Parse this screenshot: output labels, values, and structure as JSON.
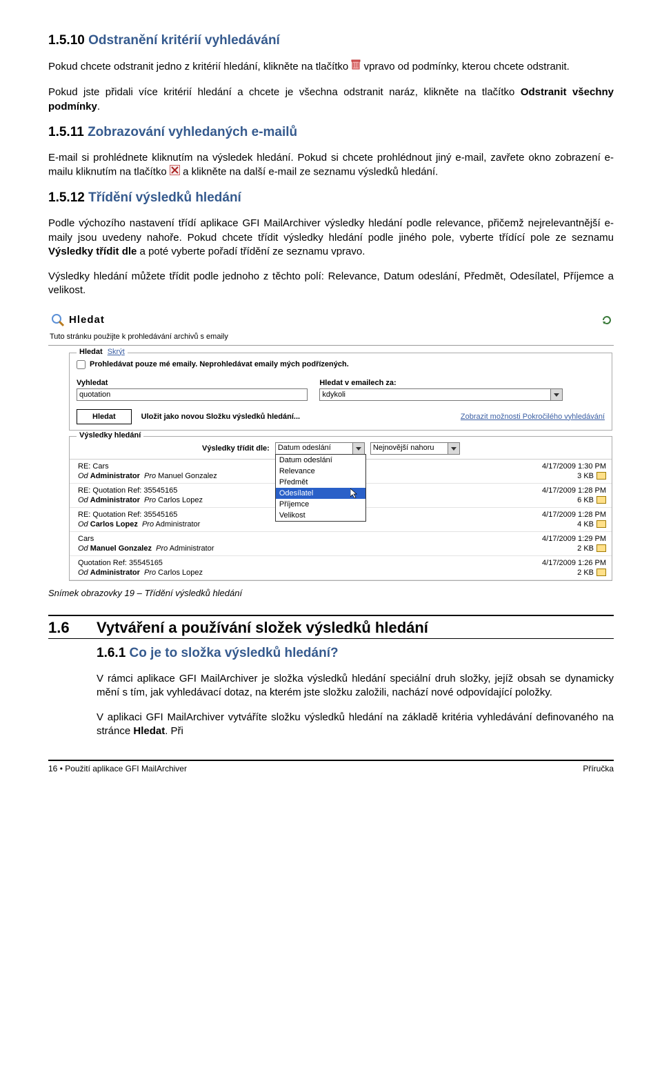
{
  "sections": {
    "s1": {
      "num": "1.5.10",
      "title": "Odstranění kritérií vyhledávání"
    },
    "s2": {
      "num": "1.5.11",
      "title": "Zobrazování vyhledaných e-mailů"
    },
    "s3": {
      "num": "1.5.12",
      "title": "Třídění výsledků hledání"
    },
    "s4": {
      "num": "1.6",
      "title": "Vytváření a používání složek výsledků hledání"
    },
    "s5": {
      "num": "1.6.1",
      "title": "Co je to složka výsledků hledání?"
    }
  },
  "para": {
    "p1a": "Pokud chcete odstranit jedno z kritérií hledání, klikněte na tlačítko ",
    "p1b": " vpravo od podmínky, kterou chcete odstranit.",
    "p2": "Pokud jste přidali více kritérií hledání a chcete je všechna odstranit naráz, klikněte na tlačítko ",
    "p2b": "Odstranit všechny podmínky",
    "p2c": ".",
    "p3a": "E-mail si prohlédnete kliknutím na výsledek hledání. Pokud si chcete prohlédnout jiný e-mail, zavřete okno zobrazení e-mailu kliknutím na tlačítko ",
    "p3b": " a klikněte na další e-mail ze seznamu výsledků hledání.",
    "p4": "Podle výchozího nastavení třídí aplikace GFI MailArchiver výsledky hledání podle relevance, přičemž nejrelevantnější e-maily jsou uvedeny nahoře. Pokud chcete třídit výsledky hledání podle jiného pole, vyberte třídící pole ze seznamu ",
    "p4b": "Výsledky třídit dle",
    "p4c": " a poté vyberte pořadí třídění ze seznamu vpravo.",
    "p5": "Výsledky hledání můžete třídit podle jednoho z těchto polí: Relevance, Datum odeslání, Předmět, Odesílatel, Příjemce a velikost.",
    "p6": "V rámci aplikace GFI MailArchiver je složka výsledků hledání speciální druh složky, jejíž obsah se dynamicky mění s tím, jak vyhledávací dotaz, na kterém jste složku založili, nachází nové odpovídající položky.",
    "p7a": "V aplikaci GFI MailArchiver vytváříte složku výsledků hledání na základě kritéria vyhledávání definovaného na stránce ",
    "p7b": "Hledat",
    "p7c": ". Při"
  },
  "screenshot": {
    "hledat_title": "Hledat",
    "subtext": "Tuto stránku použijte k prohledávání archivů s emaily",
    "panel1_legend": "Hledat",
    "panel1_legend_link": "Skrýt",
    "checkbox_label": "Prohledávat pouze mé emaily. Neprohledávat emaily mých podřízených.",
    "search_label": "Vyhledat",
    "search_value": "quotation",
    "when_label": "Hledat v emailech za:",
    "when_value": "kdykoli",
    "btn_hledat": "Hledat",
    "save_link": "Uložit jako novou Složku výsledků hledání...",
    "adv_link": "Zobrazit možnosti Pokročilého vyhledávání",
    "results_legend": "Výsledky hledání",
    "sort_label": "Výsledky třídit dle:",
    "sort_value": "Datum odeslání",
    "sort_order": "Nejnovější nahoru",
    "dropdown": [
      "Datum odeslání",
      "Relevance",
      "Předmět",
      "Odesílatel",
      "Příjemce",
      "Velikost"
    ],
    "dropdown_selected_index": 3,
    "rows": [
      {
        "subject": "RE: Cars",
        "from": "Administrator",
        "to": "Manuel Gonzalez",
        "date": "4/17/2009 1:30 PM",
        "size": "3 KB"
      },
      {
        "subject": "RE: Quotation Ref: 35545165",
        "from": "Administrator",
        "to": "Carlos Lopez",
        "date": "4/17/2009 1:28 PM",
        "size": "6 KB"
      },
      {
        "subject": "RE: Quotation Ref: 35545165",
        "from": "Carlos Lopez",
        "to": "Administrator",
        "date": "4/17/2009 1:28 PM",
        "size": "4 KB"
      },
      {
        "subject": "Cars",
        "from": "Manuel Gonzalez",
        "to": "Administrator",
        "date": "4/17/2009 1:29 PM",
        "size": "2 KB"
      },
      {
        "subject": "Quotation Ref: 35545165",
        "from": "Administrator",
        "to": "Carlos Lopez",
        "date": "4/17/2009 1:26 PM",
        "size": "2 KB"
      }
    ],
    "od": "Od",
    "pro": "Pro"
  },
  "caption": "Snímek obrazovky 19 – Třídění výsledků hledání",
  "footer": {
    "left_a": "16 ",
    "left_b": " Použití aplikace GFI MailArchiver",
    "right": "Příručka"
  }
}
